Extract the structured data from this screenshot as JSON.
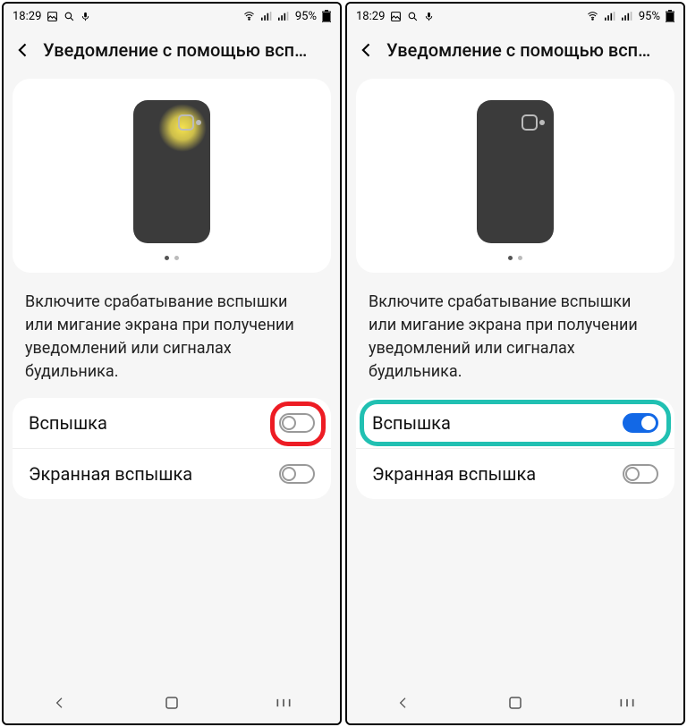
{
  "screens": [
    {
      "statusbar": {
        "time": "18:29",
        "battery_text": "95%"
      },
      "header": {
        "title": "Уведомление с помощью всп…"
      },
      "preview": {
        "flash_glow": true,
        "pager_active": 0,
        "pager_count": 2
      },
      "description": "Включите срабатывание вспышки или мигание экрана при получении уведомлений или сигналах будильника.",
      "settings": [
        {
          "label": "Вспышка",
          "on": false,
          "highlight": "red"
        },
        {
          "label": "Экранная вспышка",
          "on": false,
          "highlight": null
        }
      ]
    },
    {
      "statusbar": {
        "time": "18:29",
        "battery_text": "95%"
      },
      "header": {
        "title": "Уведомление с помощью всп…"
      },
      "preview": {
        "flash_glow": false,
        "pager_active": 0,
        "pager_count": 2
      },
      "description": "Включите срабатывание вспышки или мигание экрана при получении уведомлений или сигналах будильника.",
      "settings": [
        {
          "label": "Вспышка",
          "on": true,
          "highlight": "teal"
        },
        {
          "label": "Экранная вспышка",
          "on": false,
          "highlight": null
        }
      ]
    }
  ]
}
